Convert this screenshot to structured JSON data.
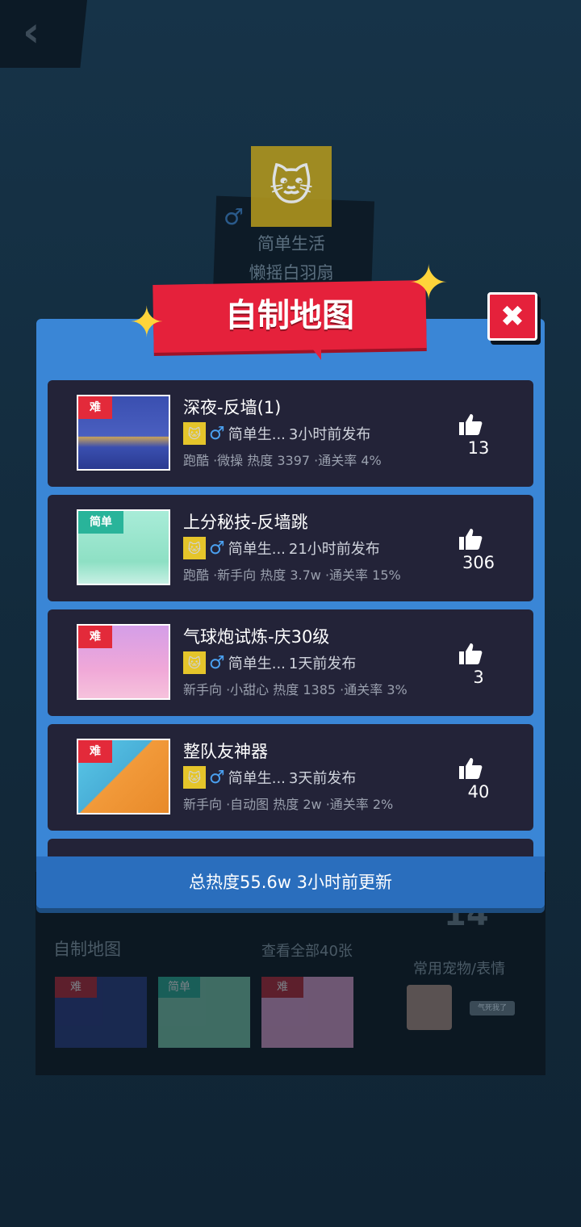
{
  "background": {
    "back_icon": "‹",
    "profile_name_1": "简单生活",
    "profile_name_2": "懒摇白羽扇",
    "section_title": "自制地图",
    "see_all": "查看全部40张",
    "big_number": "14",
    "pet_section": "常用宠物/表情",
    "pet_chip": "气死我了",
    "thumb_tags": [
      "难",
      "简单",
      "难"
    ]
  },
  "modal": {
    "title": "自制地图",
    "close_icon": "✖",
    "footer": "总热度55.6w 3小时前更新",
    "maps": [
      {
        "difficulty": "难",
        "title": "深夜-反墙(1)",
        "gender": "♂",
        "author": "简单生...",
        "published": "3小时前发布",
        "stats": "跑酷 ·微操 热度 3397 ·通关率 4%",
        "likes": "13"
      },
      {
        "difficulty": "简单",
        "title": "上分秘技-反墙跳",
        "gender": "♂",
        "author": "简单生...",
        "published": "21小时前发布",
        "stats": "跑酷 ·新手向 热度 3.7w ·通关率 15%",
        "likes": "306"
      },
      {
        "difficulty": "难",
        "title": "气球炮试炼-庆30级",
        "gender": "♂",
        "author": "简单生...",
        "published": "1天前发布",
        "stats": "新手向 ·小甜心 热度 1385 ·通关率 3%",
        "likes": "3"
      },
      {
        "difficulty": "难",
        "title": "整队友神器",
        "gender": "♂",
        "author": "简单生...",
        "published": "3天前发布",
        "stats": "新手向 ·自动图 热度 2w ·通关率 2%",
        "likes": "40"
      }
    ]
  },
  "colors": {
    "modal_blue": "#3a86d6",
    "banner_red": "#e5213b",
    "row_bg": "#232338",
    "hard_tag": "#e32a3a",
    "easy_tag": "#29b49a"
  }
}
